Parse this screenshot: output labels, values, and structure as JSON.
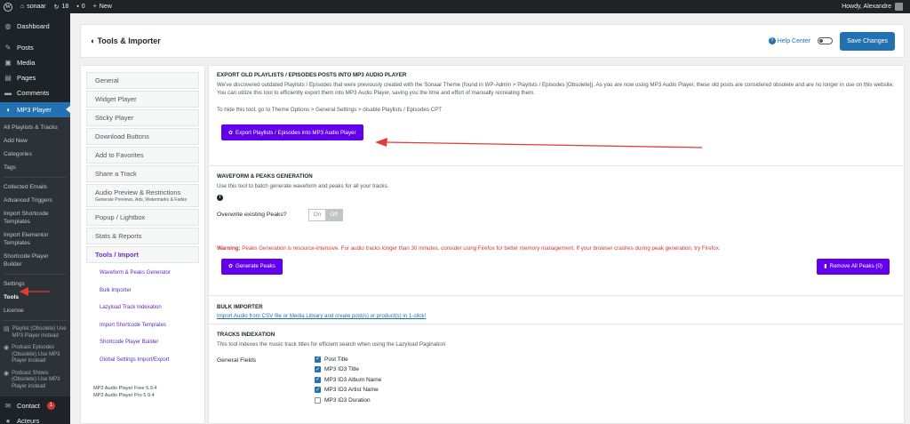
{
  "adminbar": {
    "site_name": "sonaar",
    "updates_count": "18",
    "comments_count": "0",
    "new_label": "New",
    "howdy": "Howdy, Alexandre"
  },
  "sidebar": {
    "menu": [
      {
        "label": "Dashboard",
        "icon": "dashboard-icon",
        "glyph": "◍"
      },
      {
        "label": "Posts",
        "icon": "pin-icon",
        "glyph": "✎"
      },
      {
        "label": "Media",
        "icon": "media-icon",
        "glyph": "▣"
      },
      {
        "label": "Pages",
        "icon": "page-icon",
        "glyph": "▤"
      },
      {
        "label": "Comments",
        "icon": "comment-icon",
        "glyph": "▬"
      },
      {
        "label": "MP3 Player",
        "icon": "mp3-player-icon",
        "glyph": "◖"
      }
    ],
    "submenu": [
      "All Playlists & Tracks",
      "Add New",
      "Categories",
      "Tags"
    ],
    "submenu2": [
      "Collected Emails",
      "Advanced Triggers",
      "Import Shortcode Templates",
      "Import Elementor Templates",
      "Shortcode Player Builder"
    ],
    "submenu3": [
      "Settings",
      "Tools",
      "License"
    ],
    "obsolete": [
      "Playlist (Obsolete) Use MP3 Player instead",
      "Podcast Episodes (Obsolete) Use MP3 Player instead",
      "Podcast Shows (Obsolete) Use MP3 Player instead"
    ],
    "contact_label": "Contact",
    "contact_badge": "1",
    "acteurs_label": "Acteurs"
  },
  "header": {
    "title": "Tools & Importer",
    "help_label": "Help Center",
    "save_label": "Save Changes"
  },
  "settings_nav": {
    "items": [
      "General",
      "Widget Player",
      "Sticky Player",
      "Download Buttons",
      "Add to Favorites",
      "Share a Track"
    ],
    "audio_preview_label": "Audio Preview & Restrictions",
    "audio_preview_sub": "Generate Previews, Ads, Watermarks & Fades",
    "items2": [
      "Popup / Lightbox",
      "Stats & Reports"
    ],
    "active_label": "Tools / Import",
    "subitems": [
      "Waveform & Peaks Generator",
      "Bulk Importer",
      "Lazyload Track Indexation",
      "Import Shortcode Templates",
      "Shortcode Player Builder",
      "Global Settings Import/Export"
    ],
    "version_free": "MP3 Audio Player Free 5.9.4",
    "version_pro": "MP3 Audio Player Pro 5.9.4"
  },
  "export": {
    "title": "EXPORT OLD PLAYLISTS / EPISODES POSTS INTO MP3 AUDIO PLAYER",
    "text": "We've discovered outdated Playlists / Episodes that were previously created with the Sonaar Theme (found in WP-Admin > Playlists / Episodes [Obsolete]). As you are now using MP3 Audio Player, these old posts are considered obsolete and are no longer in use on this website. You can utilize this tool to efficiently export them into MP3 Audio Player, saving you the time and effort of manually recreating them.",
    "hint": "To hide this tool, go to Theme Options > General Settings > disable Playlists / Episodes CPT",
    "button": "Export Playlists / Episodes into MP3 Audio Player"
  },
  "waveform": {
    "title": "WAVEFORM & PEAKS GENERATION",
    "text": "Use this tool to batch generate waveform and peaks for all your tracks.",
    "overwrite_label": "Overwrite existing Peaks?",
    "on": "On",
    "off": "Off",
    "warning_bold": "Warning:",
    "warning_text": " Peaks Generation is resource-intensive. For audio tracks longer than 30 minutes, consider using Firefox for better memory management. If your browser crashes during peak generation, try Firefox.",
    "generate_button": "Generate Peaks",
    "remove_button": "Remove All Peaks (0)"
  },
  "bulk": {
    "title": "BULK IMPORTER",
    "link": "Import Audio from CSV file or Media Library and create post(s) or product(s) in 1-click!"
  },
  "indexation": {
    "title": "TRACKS INDEXATION",
    "text": "This tool indexes the music track titles for efficient search when using the Lazyload Pagination",
    "fields_label": "General Fields",
    "fields": [
      {
        "label": "Post Title",
        "checked": true
      },
      {
        "label": "MP3 ID3 Title",
        "checked": true
      },
      {
        "label": "MP3 ID3 Album Name",
        "checked": true
      },
      {
        "label": "MP3 ID3 Artist Name",
        "checked": true
      },
      {
        "label": "MP3 ID3 Duration",
        "checked": false
      }
    ]
  },
  "colors": {
    "accent": "#6200ee",
    "wp_blue": "#2271b1",
    "warning": "#d63638",
    "annotation_arrow": "#e53935"
  }
}
